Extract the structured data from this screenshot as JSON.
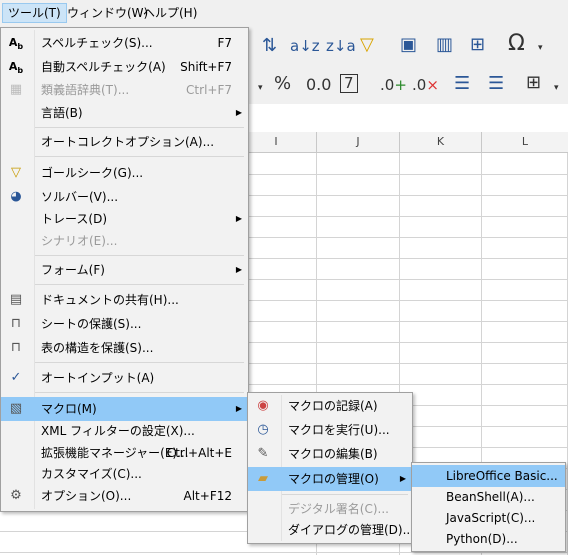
{
  "menubar": [
    {
      "label": "ツール(T)",
      "active": true
    },
    {
      "label": "ウィンドウ(W)"
    },
    {
      "label": "ヘルプ(H)"
    }
  ],
  "toolbar": {
    "font_size_value": "%",
    "icons": [
      "sort-icon",
      "sort-ascending-icon",
      "sort-descending-icon",
      "autofilter-icon",
      "insert-image-icon",
      "insert-chart-icon",
      "pivot-table-icon",
      "special-character-icon"
    ]
  },
  "sheet": {
    "column_headers": [
      "I",
      "J",
      "K",
      "L"
    ]
  },
  "tools_menu": {
    "items": [
      {
        "label": "スペルチェック(S)...",
        "shortcut": "F7",
        "icon": "spellcheck-icon"
      },
      {
        "label": "自動スペルチェック(A)",
        "shortcut": "Shift+F7",
        "icon": "auto-spellcheck-icon"
      },
      {
        "label": "類義語辞典(T)...",
        "shortcut": "Ctrl+F7",
        "icon": "thesaurus-icon",
        "disabled": true
      },
      {
        "label": "言語(B)",
        "submenu": true
      },
      {
        "label": "オートコレクトオプション(A)..."
      },
      {
        "label": "ゴールシーク(G)...",
        "icon": "goal-seek-icon"
      },
      {
        "label": "ソルバー(V)...",
        "icon": "solver-icon"
      },
      {
        "label": "トレース(D)",
        "submenu": true
      },
      {
        "label": "シナリオ(E)...",
        "disabled": true
      },
      {
        "label": "フォーム(F)",
        "submenu": true
      },
      {
        "label": "ドキュメントの共有(H)...",
        "icon": "share-document-icon"
      },
      {
        "label": "シートの保護(S)...",
        "icon": "lock-icon"
      },
      {
        "label": "表の構造を保護(S)...",
        "icon": "lock-icon"
      },
      {
        "label": "オートインプット(A)",
        "checked": true
      },
      {
        "label": "マクロ(M)",
        "submenu": true,
        "icon": "macro-icon",
        "highlighted": true
      },
      {
        "label": "XML フィルターの設定(X)..."
      },
      {
        "label": "拡張機能マネージャー(E)...",
        "shortcut": "Ctrl+Alt+E"
      },
      {
        "label": "カスタマイズ(C)..."
      },
      {
        "label": "オプション(O)...",
        "shortcut": "Alt+F12",
        "icon": "gear-icon"
      }
    ]
  },
  "macro_menu": {
    "items": [
      {
        "label": "マクロの記録(A)",
        "icon": "record-macro-icon"
      },
      {
        "label": "マクロを実行(U)...",
        "icon": "run-macro-icon"
      },
      {
        "label": "マクロの編集(B)",
        "icon": "edit-macro-icon"
      },
      {
        "label": "マクロの管理(O)",
        "submenu": true,
        "icon": "folder-icon",
        "highlighted": true
      },
      {
        "label": "デジタル署名(C)...",
        "disabled": true
      },
      {
        "label": "ダイアログの管理(D)..."
      }
    ]
  },
  "manage_menu": {
    "items": [
      {
        "label": "LibreOffice Basic...",
        "highlighted": true
      },
      {
        "label": "BeanShell(A)..."
      },
      {
        "label": "JavaScript(C)..."
      },
      {
        "label": "Python(D)..."
      }
    ]
  }
}
